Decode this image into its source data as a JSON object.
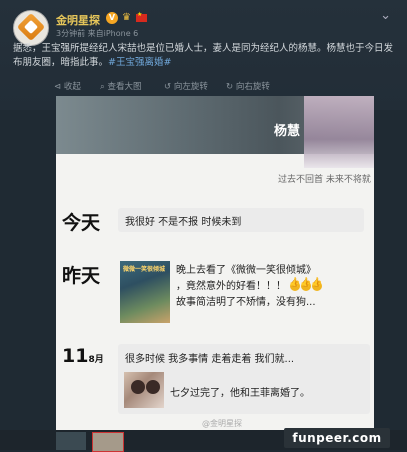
{
  "post": {
    "username": "金明星探",
    "meta": "3分钟前 来自iPhone 6",
    "text_main": "据悉，王宝强所提经纪人宋喆也是位已婚人士，妻人是同为经纪人的杨慧。杨慧也于今日发布朋友圈，暗指此事。",
    "hashtag": "#王宝强离婚#",
    "chevron": "⌄"
  },
  "image_toolbar": {
    "collapse": "收起",
    "view_large": "查看大图",
    "rotate_left": "向左旋转",
    "rotate_right": "向右旋转"
  },
  "moments": {
    "name": "杨慧",
    "slogan": "过去不回首 未来不将就",
    "today_label": "今天",
    "today_text": "我很好 不是不报 时候未到",
    "yesterday_label": "昨天",
    "poster_title": "微微一笑很倾城",
    "yesterday_line1": "晚上去看了《微微一笑很倾城》",
    "yesterday_line2": "，竟然意外的好看！！！",
    "yesterday_line3": "故事简洁明了不矫情，没有狗...",
    "day3_num": "11",
    "day3_month": "8月",
    "day3_text": "很多时候 我多事情 走着走着 我们就...",
    "day3_quote": "七夕过完了，他和王菲离婚了。",
    "watermark": "@金明星探"
  },
  "footer": {
    "site": "funpeer.com"
  },
  "icons": [
    "avatar-logo-icon",
    "vip-badge-icon",
    "crown-icon",
    "china-flag-icon",
    "chevron-down-icon",
    "thumbs-up-icon"
  ]
}
